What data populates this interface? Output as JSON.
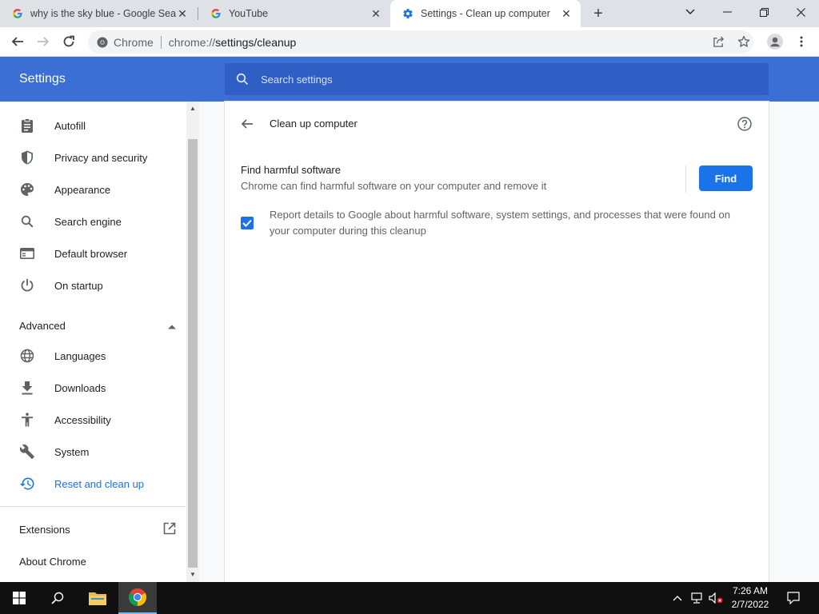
{
  "tabs": [
    {
      "title": "why is the sky blue - Google Sea",
      "icon": "google-g-icon"
    },
    {
      "title": "YouTube",
      "icon": "google-g-icon"
    },
    {
      "title": "Settings - Clean up computer",
      "icon": "gear-icon"
    }
  ],
  "omnibox": {
    "chip": "Chrome",
    "url_scheme": "chrome://",
    "url_path": "settings/cleanup"
  },
  "settings": {
    "title": "Settings",
    "search_placeholder": "Search settings"
  },
  "sidebar": {
    "items": [
      {
        "label": "Autofill",
        "icon": "clipboard-icon"
      },
      {
        "label": "Privacy and security",
        "icon": "shield-icon"
      },
      {
        "label": "Appearance",
        "icon": "palette-icon"
      },
      {
        "label": "Search engine",
        "icon": "search-icon"
      },
      {
        "label": "Default browser",
        "icon": "browser-icon"
      },
      {
        "label": "On startup",
        "icon": "power-icon"
      }
    ],
    "advanced_label": "Advanced",
    "advanced_items": [
      {
        "label": "Languages",
        "icon": "globe-icon"
      },
      {
        "label": "Downloads",
        "icon": "download-icon"
      },
      {
        "label": "Accessibility",
        "icon": "accessibility-icon"
      },
      {
        "label": "System",
        "icon": "wrench-icon"
      },
      {
        "label": "Reset and clean up",
        "icon": "restore-icon",
        "active": true
      }
    ],
    "extensions_label": "Extensions",
    "about_label": "About Chrome"
  },
  "cleanup": {
    "title": "Clean up computer",
    "find_title": "Find harmful software",
    "find_desc": "Chrome can find harmful software on your computer and remove it",
    "find_button": "Find",
    "report_checked": true,
    "report_label": "Report details to Google about harmful software, system settings, and processes that were found on your computer during this cleanup"
  },
  "taskbar": {
    "time": "7:26 AM",
    "date": "2/7/2022"
  },
  "colors": {
    "accent": "#1a73e8",
    "header": "#3b6fd6"
  }
}
